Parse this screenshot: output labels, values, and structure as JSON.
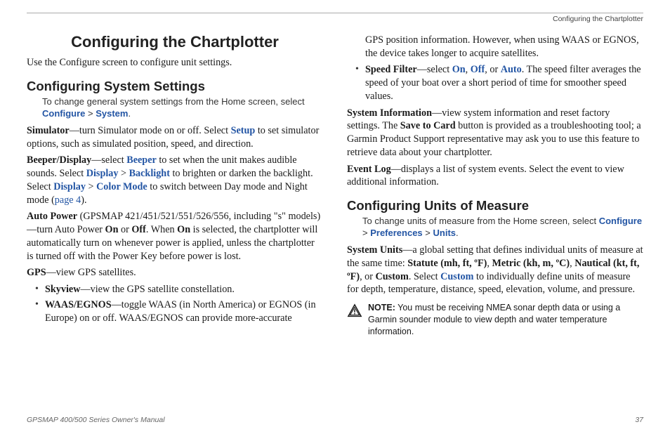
{
  "runningHead": "Configuring the Chartplotter",
  "pageTitle": "Configuring the Chartplotter",
  "intro": "Use the Configure screen to configure unit settings.",
  "sysSettings": {
    "heading": "Configuring System Settings",
    "instr_pre": "To change general system settings from the Home screen, select ",
    "instr_path1": "Configure",
    "instr_gt": " > ",
    "instr_path2": "System",
    "instr_end": ".",
    "simulator_label": "Simulator",
    "simulator_body": "—turn Simulator mode on or off. Select ",
    "simulator_setup": "Setup",
    "simulator_tail": " to set simulator options, such as simulated position, speed, and direction.",
    "beeper_label": "Beeper/Display",
    "beeper_b1": "—select ",
    "beeper_k1": "Beeper",
    "beeper_b2": " to set when the unit makes audible sounds. Select ",
    "beeper_k2": "Display",
    "beeper_gt": " > ",
    "beeper_k3": "Backlight",
    "beeper_b3": " to brighten or darken the backlight. Select ",
    "beeper_k4": "Display",
    "beeper_k5": "Color Mode",
    "beeper_b4": " to switch between Day mode and Night mode (",
    "beeper_pagelink": "page 4",
    "beeper_b5": ").",
    "autopower_label": "Auto Power",
    "autopower_models": " (GPSMAP 421/451/521/551/526/556, including \"s\" models)—turn Auto Power ",
    "autopower_on": "On",
    "autopower_or": " or ",
    "autopower_off": "Off",
    "autopower_b2": ". When ",
    "autopower_on2": "On",
    "autopower_b3": " is selected, the chartplotter will automatically turn on whenever power is applied, unless the chartplotter is turned off with the Power Key before power is lost.",
    "gps_label": "GPS",
    "gps_body": "—view GPS satellites.",
    "skyview_label": "Skyview",
    "skyview_body": "—view the GPS satellite constellation.",
    "waas_label": "WAAS/EGNOS",
    "waas_body": "—toggle WAAS (in North America) or EGNOS (in Europe) on or off. WAAS/EGNOS can provide more-accurate"
  },
  "col2": {
    "waas_cont": "GPS position information. However, when using WAAS or EGNOS, the device takes longer to acquire satellites.",
    "speed_label": "Speed Filter",
    "speed_b1": "—select ",
    "speed_on": "On",
    "speed_c1": ", ",
    "speed_off": "Off",
    "speed_c2": ", or ",
    "speed_auto": "Auto",
    "speed_b2": ". The speed filter averages the speed of your boat over a short period of time for smoother speed values.",
    "sysinfo_label": "System Information",
    "sysinfo_b1": "—view system information and reset factory settings. The ",
    "sysinfo_save": "Save to Card",
    "sysinfo_b2": " button is provided as a troubleshooting tool; a Garmin Product Support representative may ask you to use this feature to retrieve data about your chartplotter.",
    "eventlog_label": "Event Log",
    "eventlog_body": "—displays a list of system events. Select the event to view additional information."
  },
  "units": {
    "heading": "Configuring Units of Measure",
    "instr_pre": "To change units of measure from the Home screen, select ",
    "instr_p1": "Configure",
    "instr_gt": " > ",
    "instr_p2": "Preferences",
    "instr_p3": "Units",
    "instr_end": ".",
    "sysunits_label": "System Units",
    "sysunits_b1": "—a global setting that defines individual units of measure at the same time: ",
    "sysunits_statute": "Statute (mh, ft, ºF)",
    "sysunits_c1": ", ",
    "sysunits_metric": "Metric (kh, m, ºC)",
    "sysunits_c2": ", ",
    "sysunits_nautical": "Nautical (kt, ft, ºF)",
    "sysunits_c3": ", or ",
    "sysunits_custom": "Custom",
    "sysunits_b2": ". Select ",
    "sysunits_customlink": "Custom",
    "sysunits_b3": " to individually define units of measure for depth, temperature, distance, speed, elevation, volume, and pressure."
  },
  "note": {
    "label": "NOTE:",
    "body": " You must be receiving NMEA sonar depth data or using a Garmin sounder module to view depth and water temperature information."
  },
  "footer": {
    "manual": "GPSMAP 400/500 Series Owner's Manual",
    "page": "37"
  }
}
